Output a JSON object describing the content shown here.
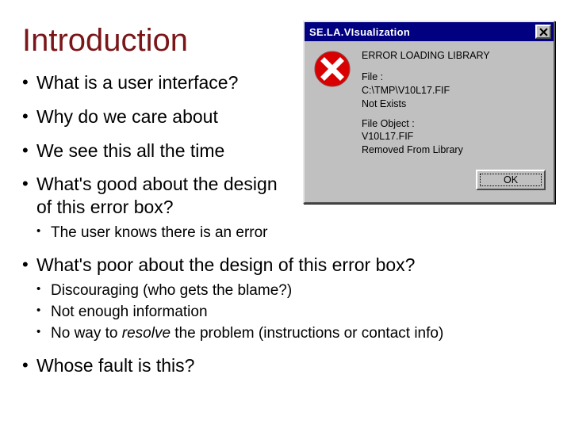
{
  "title": "Introduction",
  "bullets": {
    "b1": "What is a user interface?",
    "b2": "Why do we care about",
    "b3": "We see this all the time",
    "b4": "What's good about the design of this error box?",
    "b4_sub": {
      "s1": "The user knows there is an error"
    },
    "b5": "What's poor about the design of this error box?",
    "b5_sub": {
      "s1": "Discouraging (who gets the blame?)",
      "s2": "Not enough information",
      "s3_a": "No way to ",
      "s3_b": "resolve",
      "s3_c": " the problem (instructions or contact info)"
    },
    "b6": "Whose fault is this?"
  },
  "dialog": {
    "title": "SE.LA.VIsualization",
    "heading": "ERROR LOADING LIBRARY",
    "file_label": "File :",
    "file_path": "C:\\TMP\\V10L17.FIF",
    "file_status": "Not Exists",
    "obj_label": "File Object :",
    "obj_name": "V10L17.FIF",
    "obj_status": "Removed From Library",
    "ok": "OK"
  }
}
